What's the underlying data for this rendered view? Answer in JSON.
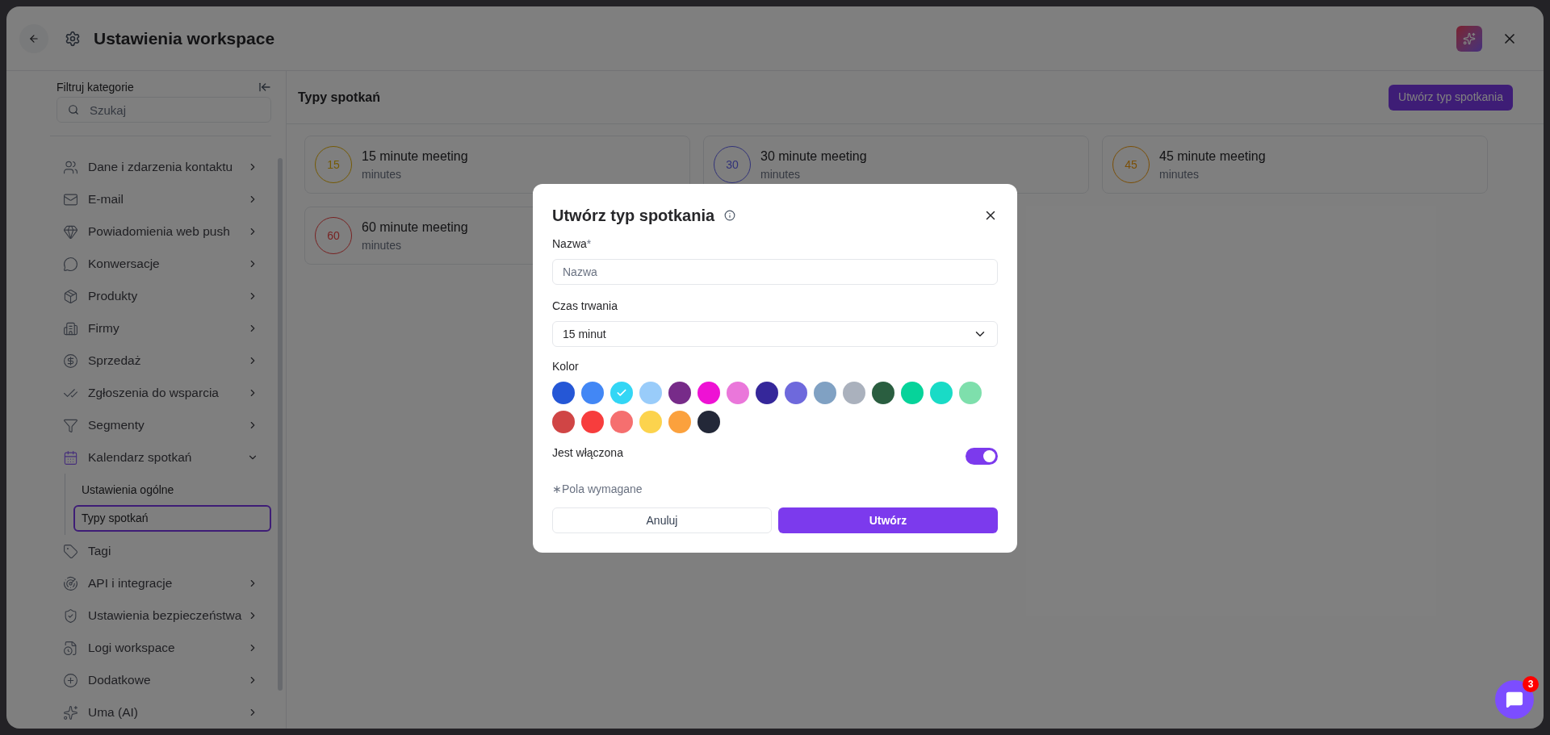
{
  "header": {
    "title": "Ustawienia workspace"
  },
  "sidebar": {
    "title": "Filtruj kategorie",
    "search": {
      "placeholder": "Szukaj"
    },
    "items": [
      {
        "label": "Dane i zdarzenia kontaktu",
        "kind": "group"
      },
      {
        "label": "E-mail",
        "kind": "group"
      },
      {
        "label": "Powiadomienia web push",
        "kind": "group"
      },
      {
        "label": "Konwersacje",
        "kind": "group"
      },
      {
        "label": "Produkty",
        "kind": "group"
      },
      {
        "label": "Firmy",
        "kind": "group"
      },
      {
        "label": "Sprzedaż",
        "kind": "group"
      },
      {
        "label": "Zgłoszenia do wsparcia",
        "kind": "group"
      },
      {
        "label": "Segmenty",
        "kind": "group"
      },
      {
        "label": "Kalendarz spotkań",
        "kind": "group",
        "expanded": true,
        "children": [
          {
            "label": "Ustawienia ogólne",
            "selected": false
          },
          {
            "label": "Typy spotkań",
            "selected": true
          }
        ]
      },
      {
        "label": "Tagi",
        "kind": "link"
      },
      {
        "label": "API i integracje",
        "kind": "group"
      },
      {
        "label": "Ustawienia bezpieczeństwa",
        "kind": "group"
      },
      {
        "label": "Logi workspace",
        "kind": "group"
      },
      {
        "label": "Dodatkowe",
        "kind": "group"
      },
      {
        "label": "Uma (AI)",
        "kind": "group"
      }
    ]
  },
  "main": {
    "title": "Typy spotkań",
    "create_button": "Utwórz typ spotkania",
    "meeting_types": [
      {
        "badge": "15",
        "name": "15 minute meeting",
        "unit": "minutes",
        "color": "#755a04"
      },
      {
        "badge": "30",
        "name": "30 minute meeting",
        "unit": "minutes",
        "color": "#323379"
      },
      {
        "badge": "45",
        "name": "45 minute meeting",
        "unit": "minutes",
        "color": "#7b4f06"
      },
      {
        "badge": "60",
        "name": "60 minute meeting",
        "unit": "minutes",
        "color": "#782222"
      }
    ]
  },
  "dialog": {
    "title": "Utwórz typ spotkania",
    "name_label": "Nazwa",
    "required_mark": "*",
    "name_field": {
      "placeholder": "Nazwa"
    },
    "duration_label": "Czas trwania",
    "duration_value": "15 minut",
    "color_label": "Kolor",
    "swatches": [
      {
        "color": "#2557d6",
        "selected": false
      },
      {
        "color": "#4287f5",
        "selected": false
      },
      {
        "color": "#33d6f5",
        "selected": true
      },
      {
        "color": "#99ccfa",
        "selected": false
      },
      {
        "color": "#772b89",
        "selected": false
      },
      {
        "color": "#ee12d4",
        "selected": false
      },
      {
        "color": "#ea77da",
        "selected": false
      },
      {
        "color": "#35279a",
        "selected": false
      },
      {
        "color": "#6e69dc",
        "selected": false
      },
      {
        "color": "#80a1c3",
        "selected": false
      },
      {
        "color": "#aab1bd",
        "selected": false
      },
      {
        "color": "#2a5e40",
        "selected": false
      },
      {
        "color": "#06d39a",
        "selected": false
      },
      {
        "color": "#19dbc6",
        "selected": false
      },
      {
        "color": "#7edfac",
        "selected": false
      },
      {
        "color": "#d04545",
        "selected": false
      },
      {
        "color": "#f73d3d",
        "selected": false
      },
      {
        "color": "#f56f6f",
        "selected": false
      },
      {
        "color": "#fcd34d",
        "selected": false
      },
      {
        "color": "#fba13d",
        "selected": false
      },
      {
        "color": "#232838",
        "selected": false
      }
    ],
    "enabled_label": "Jest włączona",
    "enabled": true,
    "required_note": "∗Pola wymagane",
    "cancel_button": "Anuluj",
    "submit_button": "Utwórz"
  },
  "chat": {
    "badge": "3"
  }
}
